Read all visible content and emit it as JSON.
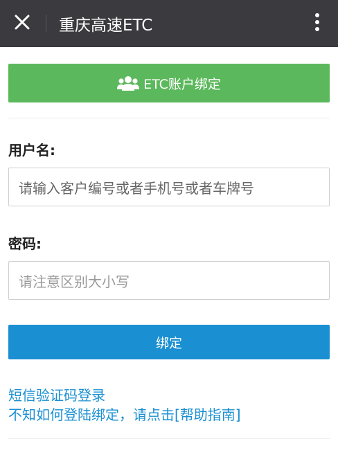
{
  "header": {
    "title": "重庆高速ETC",
    "close_icon": "close-icon",
    "more_icon": "more-vertical-icon",
    "bg_color": "#3a3a3f"
  },
  "bind_account": {
    "label": "ETC账户绑定",
    "icon": "users-icon",
    "color": "#5cb85c"
  },
  "form": {
    "username_label": "用户名:",
    "username_placeholder": "请输入客户编号或者手机号或者车牌号",
    "password_label": "密码:",
    "password_placeholder": "请注意区别大小写"
  },
  "submit": {
    "label": "绑定",
    "color": "#1a8fd2"
  },
  "links": {
    "sms_login": "短信验证码登录",
    "help": "不知如何登陆绑定，请点击[帮助指南]"
  }
}
